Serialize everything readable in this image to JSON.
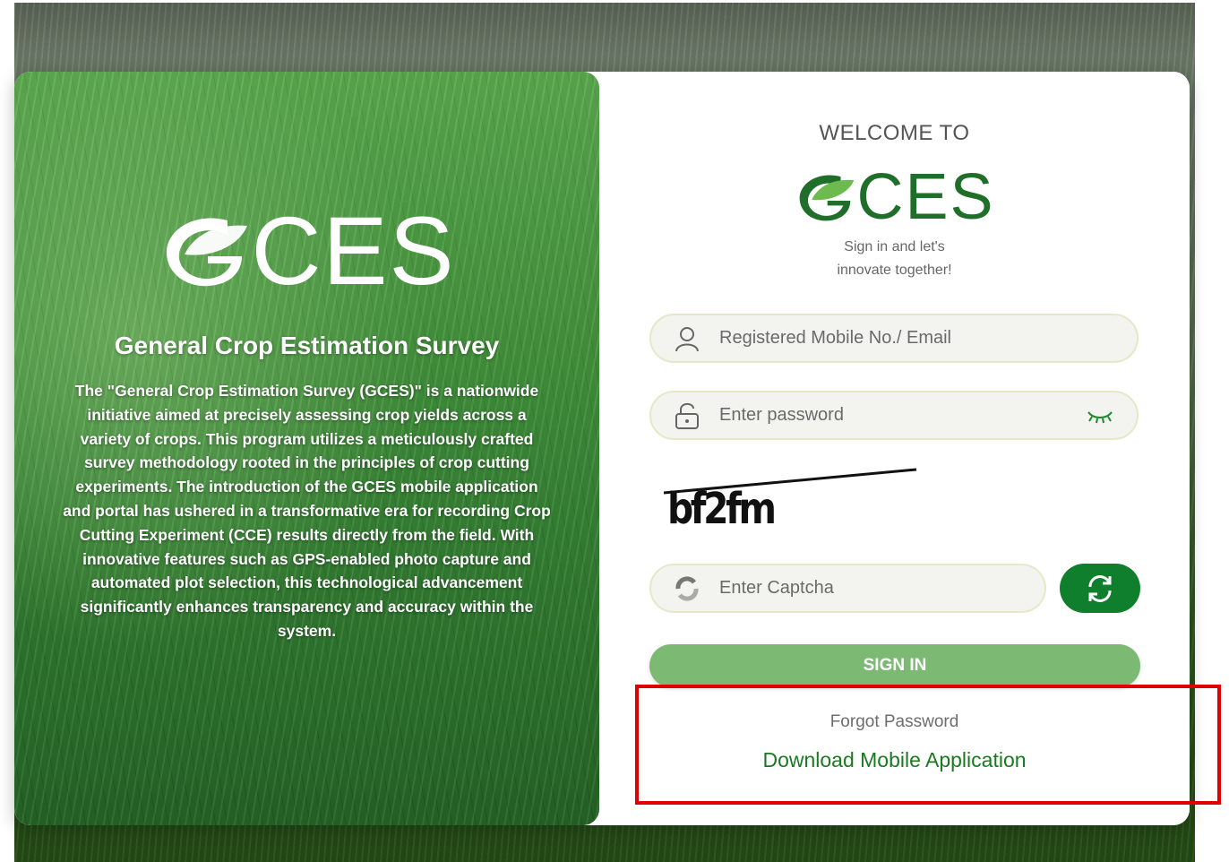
{
  "left_panel": {
    "logo_text": "CES",
    "title": "General Crop Estimation Survey",
    "description": "The \"General Crop Estimation Survey (GCES)\" is a nationwide initiative aimed at precisely assessing crop yields across a variety of crops. This program utilizes a meticulously crafted survey methodology rooted in the principles of crop cutting experiments. The introduction of the GCES mobile application and portal has ushered in a transformative era for recording Crop Cutting Experiment (CCE) results directly from the field. With innovative features such as GPS-enabled photo capture and automated plot selection, this technological advancement significantly enhances transparency and accuracy within the system."
  },
  "login": {
    "welcome": "WELCOME TO",
    "logo_text": "CES",
    "tagline_line1": "Sign in and let's",
    "tagline_line2": "innovate together!",
    "username_placeholder": "Registered Mobile No./ Email",
    "password_placeholder": "Enter password",
    "captcha_text": "bf2fm",
    "captcha_placeholder": "Enter Captcha",
    "signin_label": "SIGN IN",
    "forgot_label": "Forgot Password",
    "download_label": "Download Mobile Application"
  },
  "colors": {
    "brand_dark_green": "#1f6f2b",
    "leaf_green": "#5fb34c",
    "button_green": "#0f7f2e",
    "signin_green": "#7cba73",
    "highlight_red": "#e00000"
  },
  "icons": {
    "username": "user-icon",
    "password": "lock-icon",
    "toggle": "eye-closed-icon",
    "captcha": "captcha-refresh-icon",
    "refresh": "refresh-icon"
  }
}
